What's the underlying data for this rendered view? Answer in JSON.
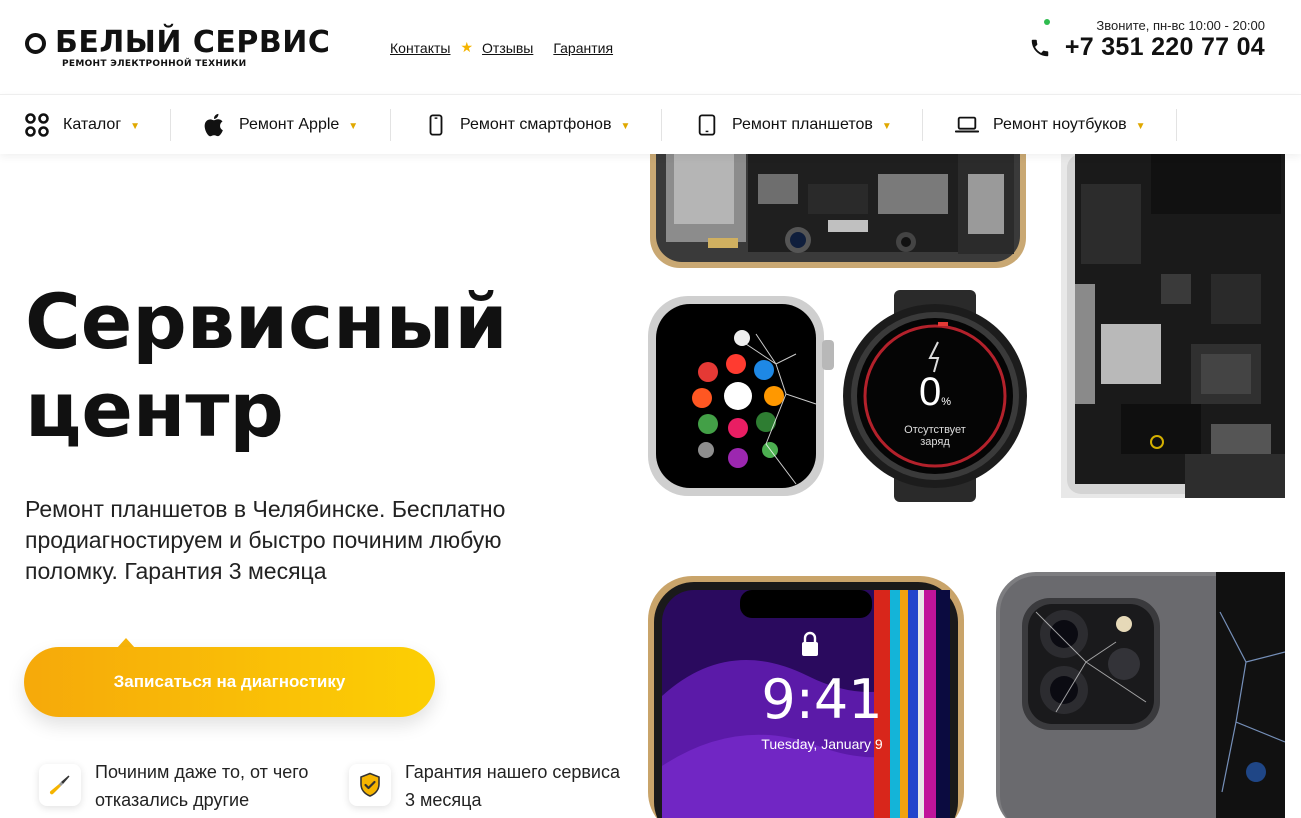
{
  "logo": {
    "title": "БЕЛЫЙ СЕРВИС",
    "subtitle": "РЕМОНТ ЭЛЕКТРОННОЙ ТЕХНИКИ"
  },
  "top_links": {
    "contacts": "Контакты",
    "reviews": "Отзывы",
    "guarantee": "Гарантия"
  },
  "contact": {
    "hours": "Звоните, пн-вс 10:00 - 20:00",
    "phone": "+7 351 220 77 04"
  },
  "nav": {
    "items": [
      {
        "label": "Каталог",
        "icon": "grid-icon"
      },
      {
        "label": "Ремонт Apple",
        "icon": "apple-icon"
      },
      {
        "label": "Ремонт смартфонов",
        "icon": "smartphone-icon"
      },
      {
        "label": "Ремонт планшетов",
        "icon": "tablet-icon"
      },
      {
        "label": "Ремонт ноутбуков",
        "icon": "laptop-icon"
      }
    ]
  },
  "hero": {
    "title_line1": "Сервисный",
    "title_line2": "центр",
    "description": "Ремонт планшетов в Челябинске. Бесплатно продиагностируем и быстро починим любую поломку. Гарантия 3 месяца",
    "cta_label": "Записаться на диагностику"
  },
  "features": [
    {
      "line1": "Починим даже то, от чего",
      "line2": "отказались другие",
      "icon": "screwdriver-icon"
    },
    {
      "line1": "Гарантия нашего сервиса",
      "line2": "3 месяца",
      "icon": "shield-check-icon"
    }
  ],
  "collage": {
    "watch_percent": "0",
    "watch_percent_unit": "%",
    "watch_status_line1": "Отсутствует",
    "watch_status_line2": "заряд",
    "phone_time": "9:41",
    "phone_date": "Tuesday, January 9"
  },
  "colors": {
    "accent": "#f6a90a",
    "accent_end": "#fccf04",
    "status_online": "#2ebc4f"
  }
}
